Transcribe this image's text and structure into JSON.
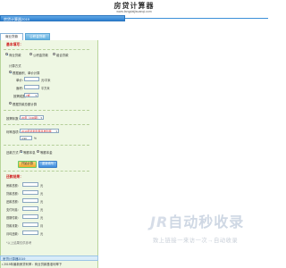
{
  "header": {
    "title": "房贷计算器",
    "url": "www.fangdaijisuanqi.com"
  },
  "topbar": {
    "label": "房贷计算器2019"
  },
  "tabs": [
    {
      "label": "商业贷款"
    },
    {
      "label": "公积金贷款"
    }
  ],
  "form": {
    "section_title": "基本填写：",
    "loan_types": [
      "商业贷款",
      "公积金贷款",
      "组合贷款"
    ],
    "calc_method_label": "计算方式",
    "method_area": "根据面积、单价计算",
    "unit_price_label": "单价：",
    "unit_price_unit": "元/平米",
    "area_label": "面积：",
    "area_unit": "平方米",
    "down_payment_label": "按揭成数：",
    "down_payment_value": "7成",
    "method_total": "根据贷款总额计算",
    "term_label": "按揭年数：",
    "term_value": "20年（240期）",
    "rate_label": "利率选项：",
    "rate_value": "2019年最新利率基准利率",
    "rate_number": "4.90",
    "rate_unit": "%",
    "repay_label": "还款方式：",
    "repay_options": [
      "等额本息",
      "等额本金"
    ],
    "calc_button": "开始计算",
    "reset_button": "重新填写"
  },
  "results": {
    "title": "还款结果：",
    "rows": [
      {
        "label": "房款总额：",
        "unit": "元"
      },
      {
        "label": "贷款总额：",
        "unit": "元"
      },
      {
        "label": "还款总额：",
        "unit": "元"
      },
      {
        "label": "支付利息：",
        "unit": "元"
      },
      {
        "label": "首期付款：",
        "unit": "元"
      },
      {
        "label": "贷款月数：",
        "unit": "月"
      },
      {
        "label": "月均还款：",
        "unit": "元"
      }
    ],
    "note": "*以上结果仅供参考"
  },
  "bottom": {
    "bar_label": "房贷计算器2019",
    "news": "• 2019年最新房贷利率：商业贷款基准利率下"
  },
  "watermark": {
    "brand_latin": "JR",
    "brand_cn": "自动秒收录",
    "slogan": "致上链接一来访一次→自动收录"
  }
}
